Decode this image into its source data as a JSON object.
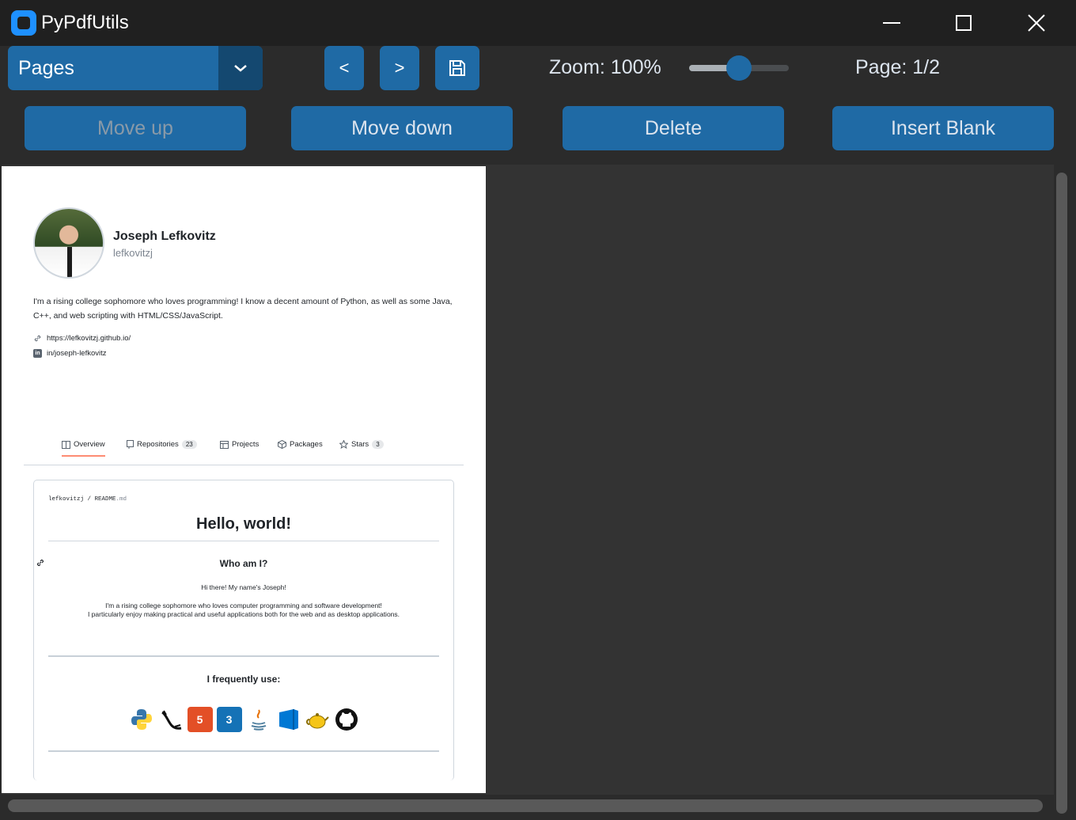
{
  "app": {
    "title": "PyPdfUtils"
  },
  "toolbar": {
    "mode_select": "Pages",
    "prev_label": "<",
    "next_label": ">",
    "zoom_label": "Zoom: 100%",
    "zoom_level_fraction": 0.5,
    "page_label": "Page: 1/2"
  },
  "actions": {
    "move_up": "Move up",
    "move_down": "Move down",
    "delete": "Delete",
    "insert_blank": "Insert Blank"
  },
  "colors": {
    "accent": "#1f6aa5",
    "accent_dark": "#144870",
    "background": "#2b2b2b",
    "titlebar": "#202020"
  },
  "document": {
    "profile": {
      "name": "Joseph Lefkovitz",
      "handle": "lefkovitzj",
      "bio": "I'm a rising college sophomore who loves programming! I know a decent amount of Python, as well as some Java, C++, and web scripting with HTML/CSS/JavaScript.",
      "website": "https://lefkovitzj.github.io/",
      "linkedin": "in/joseph-lefkovitz"
    },
    "tabs": [
      {
        "label": "Overview",
        "count": ""
      },
      {
        "label": "Repositories",
        "count": "23"
      },
      {
        "label": "Projects",
        "count": ""
      },
      {
        "label": "Packages",
        "count": ""
      },
      {
        "label": "Stars",
        "count": "3"
      }
    ],
    "readme": {
      "path_user": "lefkovitzj",
      "path_sep": " / ",
      "path_file": "README",
      "path_ext": ".md",
      "heading": "Hello, world!",
      "subheading": "Who am I?",
      "greeting": "Hi there! My name's Joseph!",
      "line1": "I'm a rising college sophomore who loves computer programming and software development!",
      "line2": "I particularly enjoy making practical and useful applications both for the web and as desktop applications.",
      "uses_heading": "I frequently use:",
      "tools": [
        "python-icon",
        "flask-icon",
        "html5-icon",
        "css3-icon",
        "java-icon",
        "vscode-icon",
        "teapot-icon",
        "github-icon"
      ]
    }
  }
}
